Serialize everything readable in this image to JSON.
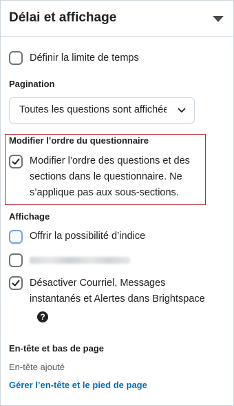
{
  "header": {
    "title": "Délai et affichage"
  },
  "time_limit": {
    "label": "Définir la limite de temps",
    "checked": false
  },
  "pagination": {
    "heading": "Pagination",
    "selected": "Toutes les questions sont affichées sur une page"
  },
  "order": {
    "heading": "Modifier l’ordre du questionnaire",
    "checkbox_label": "Modifier l’ordre des questions et des sections dans le questionnaire. Ne s’applique pas aux sous-sections.",
    "checked": true,
    "highlight_color": "#b8262f"
  },
  "display": {
    "heading": "Affichage",
    "hint": {
      "label": "Offrir la possibilité d’indice",
      "checked": false
    },
    "blurred_option": {
      "checked": false
    },
    "disable_alerts": {
      "label": "Désactiver Courriel, Messages instantanés et Alertes dans Brightspace",
      "checked": true
    },
    "help_icon": "question-circle-icon"
  },
  "header_footer": {
    "heading": "En-tête et bas de page",
    "status": "En-tête ajouté",
    "link": "Gérer l’en-tête et le pied de page",
    "link_color": "#006fbf"
  }
}
